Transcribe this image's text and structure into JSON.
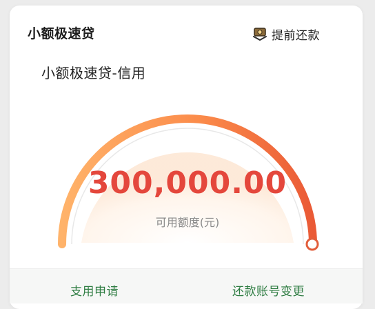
{
  "header": {
    "title": "小额极速贷",
    "prepay_label": "提前还款",
    "prepay_icon": "repayment-icon"
  },
  "product": {
    "name": "小额极速贷-信用"
  },
  "credit": {
    "amount": "300,000.00",
    "amount_label": "可用额度(元)",
    "amount_color": "#e4473c",
    "gauge_usage_fraction": 1.0
  },
  "actions": {
    "usage_application": "支用申请",
    "change_repayment_account": "还款账号变更"
  },
  "colors": {
    "accent_green": "#2f7d43",
    "gauge_start": "#ffb36a",
    "gauge_end": "#ea5a36"
  }
}
